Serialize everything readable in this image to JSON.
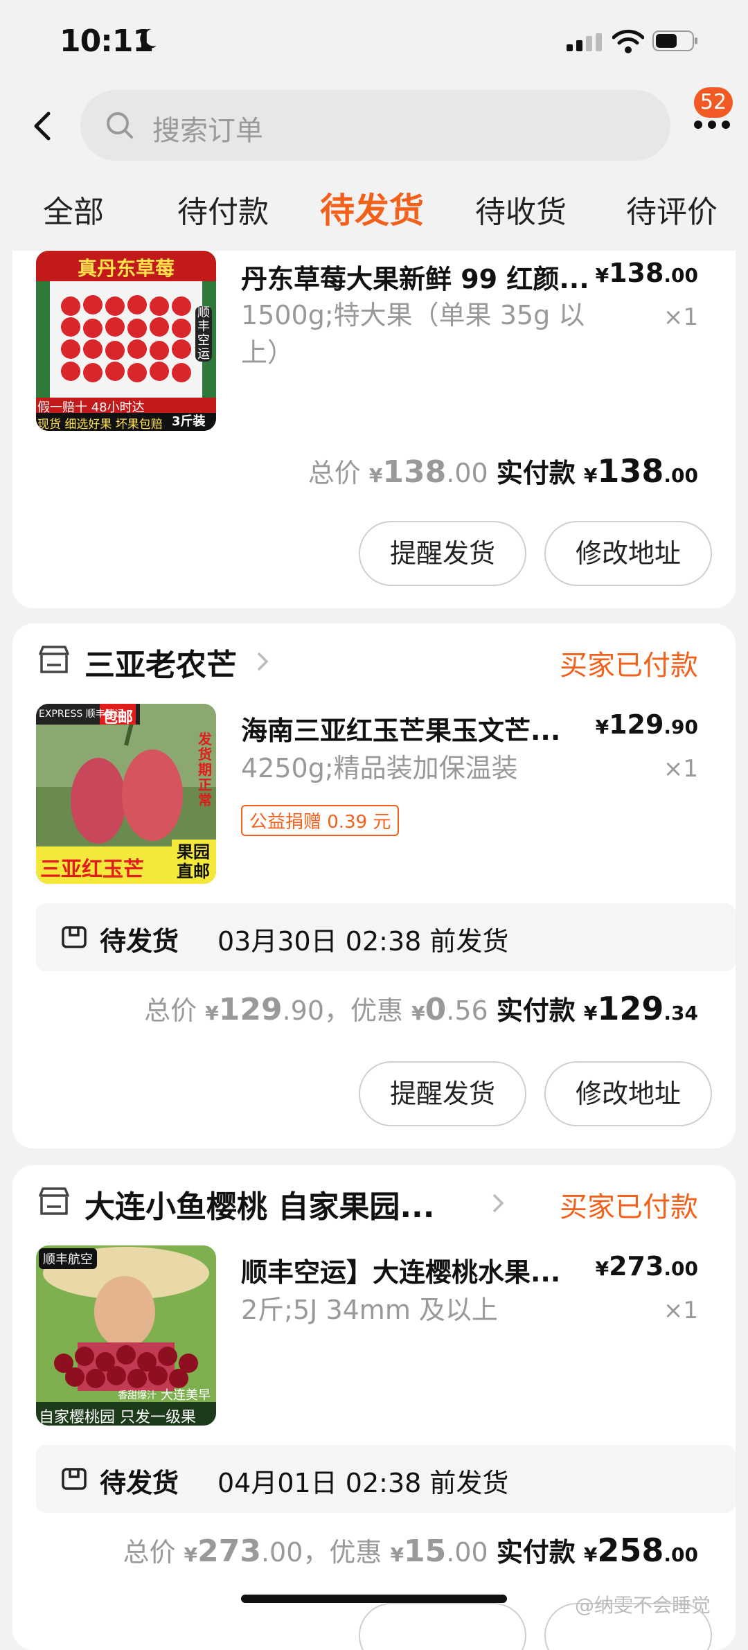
{
  "status_bar": {
    "time": "10:11"
  },
  "search": {
    "placeholder": "搜索订单"
  },
  "badge": "52",
  "tabs": [
    "全部",
    "待付款",
    "待发货",
    "待收货",
    "待评价"
  ],
  "active_tab": 2,
  "orders": [
    {
      "product_title": "丹东草莓大果新鲜 99 红颜...",
      "spec": "1500g;特大果（单果 35g 以上）",
      "price_int": "138",
      "price_dec": ".00",
      "qty": "×1",
      "thumb": {
        "top_text": "真丹东草莓",
        "badge": "顺丰空运",
        "bottom1": "假一赔十 48小时达",
        "bottom2": "现货 细选好果 坏果包赔",
        "pkg": "3斤装"
      },
      "summary": {
        "total_label": "总价",
        "total_int": "138",
        "total_dec": ".00",
        "pay_label": "实付款",
        "pay_int": "138",
        "pay_dec": ".00"
      },
      "buttons": [
        "提醒发货",
        "修改地址"
      ]
    },
    {
      "shop": "三亚老农芒",
      "status": "买家已付款",
      "product_title": "海南三亚红玉芒果玉文芒...",
      "spec": "4250g;精品装加保温装",
      "tag": "公益捐赠 0.39 元",
      "price_int": "129",
      "price_dec": ".90",
      "qty": "×1",
      "thumb": {
        "badge1": "EXPRESS 顺丰速运",
        "badge2": "包邮",
        "side": "发货期正常",
        "bottom": "三亚红玉芒",
        "corner": "果园直邮"
      },
      "ship": {
        "label": "待发货",
        "text": "03月30日 02:38 前发货"
      },
      "summary": {
        "total_label": "总价",
        "total_int": "129",
        "total_dec": ".90",
        "disc_label": "，优惠",
        "disc_int": "0",
        "disc_dec": ".56",
        "pay_label": "实付款",
        "pay_int": "129",
        "pay_dec": ".34"
      },
      "buttons": [
        "提醒发货",
        "修改地址"
      ]
    },
    {
      "shop": "大连小鱼樱桃 自家果园...",
      "status": "买家已付款",
      "product_title": "顺丰空运】大连樱桃水果...",
      "spec": "2斤;5J 34mm 及以上",
      "price_int": "273",
      "price_dec": ".00",
      "qty": "×1",
      "thumb": {
        "badge": "顺丰航空",
        "tag1": "香甜爆汁",
        "tag2": "大连美早",
        "bottom": "自家樱桃园 只发一级果"
      },
      "ship": {
        "label": "待发货",
        "text": "04月01日 02:38 前发货"
      },
      "summary": {
        "total_label": "总价",
        "total_int": "273",
        "total_dec": ".00",
        "disc_label": "，优惠",
        "disc_int": "15",
        "disc_dec": ".00",
        "pay_label": "实付款",
        "pay_int": "258",
        "pay_dec": ".00"
      }
    }
  ],
  "currency": "¥",
  "watermark": "@纳雯不会睡觉",
  "colors": {
    "accent": "#f2611c",
    "badge": "#f15a24",
    "bg": "#f2f2f2"
  }
}
